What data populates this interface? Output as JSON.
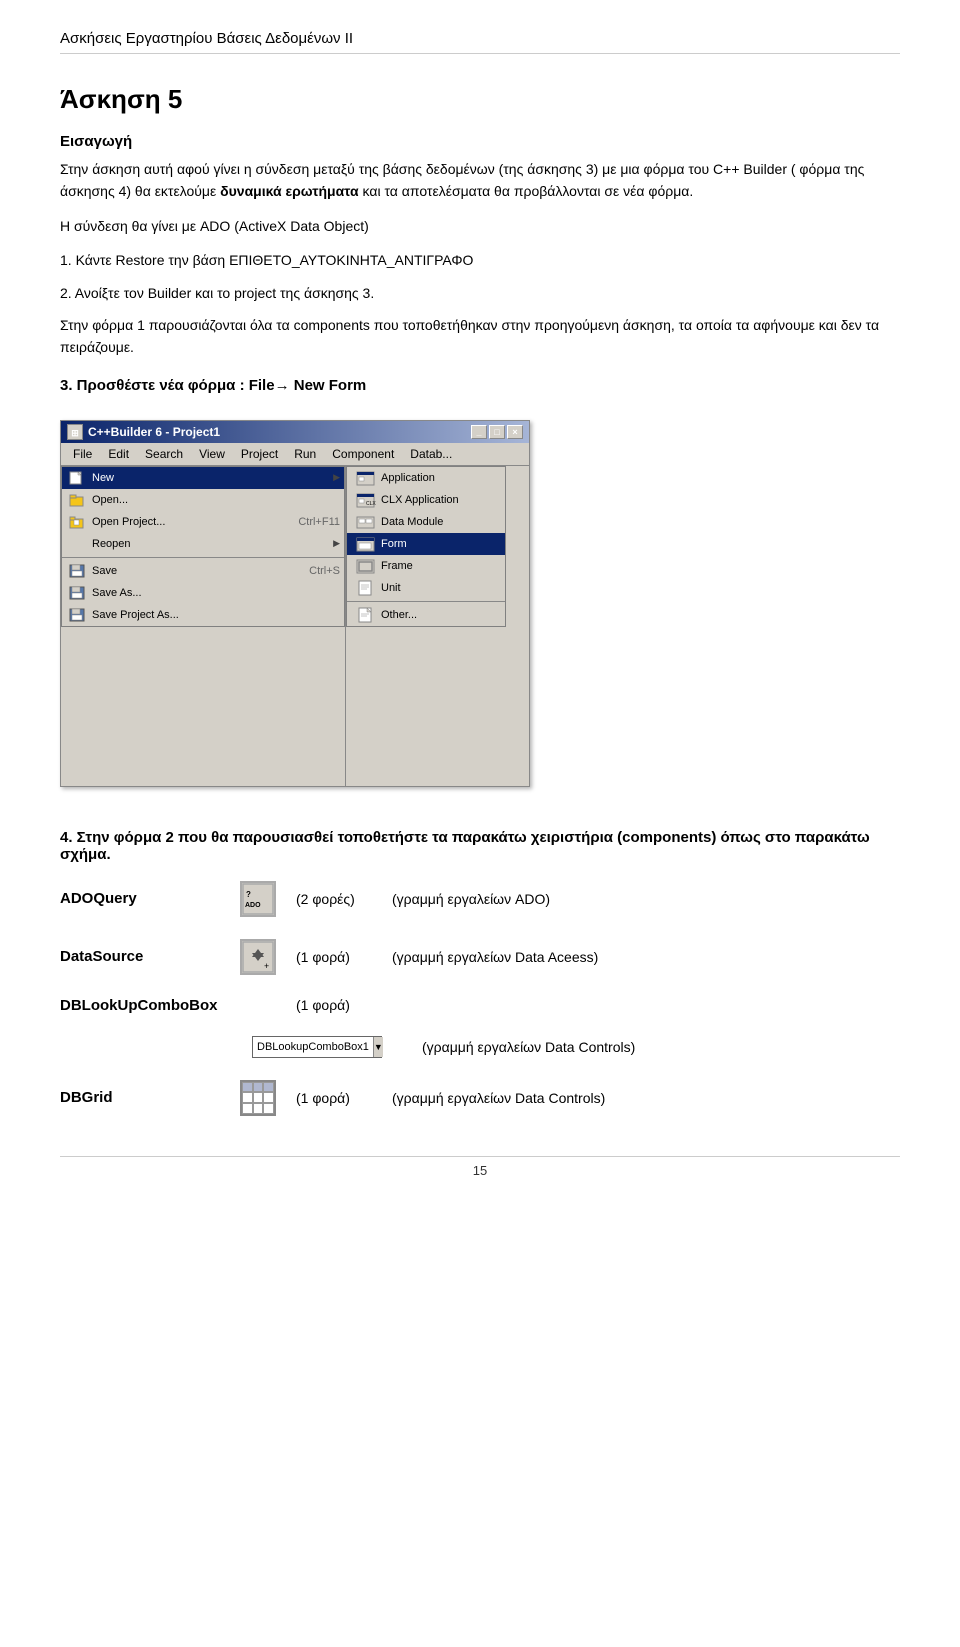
{
  "header": {
    "title": "Ασκήσεις Εργαστηρίου Βάσεις Δεδομένων ΙΙ"
  },
  "exercise": {
    "title": "Άσκηση 5",
    "intro_heading": "Εισαγωγή",
    "intro_p1": "Στην άσκηση αυτή αφού γίνει η σύνδεση μεταξύ της βάσης δεδομένων (της άσκησης 3) με μια φόρμα του  C++ Builder ( φόρμα της άσκησης 4) θα εκτελούμε ",
    "intro_p1_bold": "δυναμικά ερωτήματα",
    "intro_p1_end": " και τα αποτελέσματα θα προβάλλονται σε νέα φόρμα.",
    "intro_p2": "Η σύνδεση θα γίνει με ADO (ActiveX  Data Object)",
    "step1": "1. Κάντε Restore την βάση ΕΠΙΘΕΤΟ_ΑΥΤΟΚΙΝΗΤΑ_ΑΝΤΙΓΡΑΦΟ",
    "step2": "2. Ανοίξτε τον Builder και το project της άσκησης 3.",
    "step3_p": "Στην φόρμα 1 παρουσιάζονται όλα τα components που τοποθετήθηκαν στην προηγούμενη άσκηση, τα οποία τα αφήνουμε και δεν τα πειράζουμε.",
    "step3_heading": "3. Προσθέστε νέα φόρμα : File→ New Form",
    "step4_heading": "4. Στην φόρμα 2 που θα παρουσιασθεί τοποθετήστε τα παρακάτω χειριστήρια (components) όπως στο παρακάτω σχήμα.",
    "screenshot": {
      "title_bar": "C++Builder 6 - Project1",
      "menu_items": [
        "File",
        "Edit",
        "Search",
        "View",
        "Project",
        "Run",
        "Component",
        "Datab..."
      ],
      "file_menu": {
        "new_label": "New",
        "open_label": "Open...",
        "open_project_label": "Open Project...",
        "open_project_shortcut": "Ctrl+F11",
        "reopen_label": "Reopen",
        "save_label": "Save",
        "save_shortcut": "Ctrl+S",
        "save_as_label": "Save As...",
        "save_project_as_label": "Save Project As..."
      },
      "new_submenu": {
        "application_label": "Application",
        "clx_application_label": "CLX Application",
        "data_module_label": "Data Module",
        "form_label": "Form",
        "frame_label": "Frame",
        "unit_label": "Unit",
        "other_label": "Other..."
      }
    },
    "components": [
      {
        "name": "ADOQuery",
        "icon_type": "ado",
        "count": "(2 φορές)",
        "description": "(γραμμή εργαλείων ADO)"
      },
      {
        "name": "DataSource",
        "icon_type": "datasource",
        "count": "(1 φορά)",
        "description": "(γραμμή εργαλείων Data Aceess)"
      },
      {
        "name": "DBLookUpComboBox",
        "icon_type": "dblookup",
        "count": "(1 φορά)",
        "combo_label": "DBLookupComboBox1",
        "description": "(γραμμή εργαλείων Data Controls)"
      },
      {
        "name": "DBGrid",
        "icon_type": "dbgrid",
        "count": "(1 φορά)",
        "description": "(γραμμή εργαλείων Data Controls)"
      }
    ]
  },
  "footer": {
    "page_number": "15"
  }
}
